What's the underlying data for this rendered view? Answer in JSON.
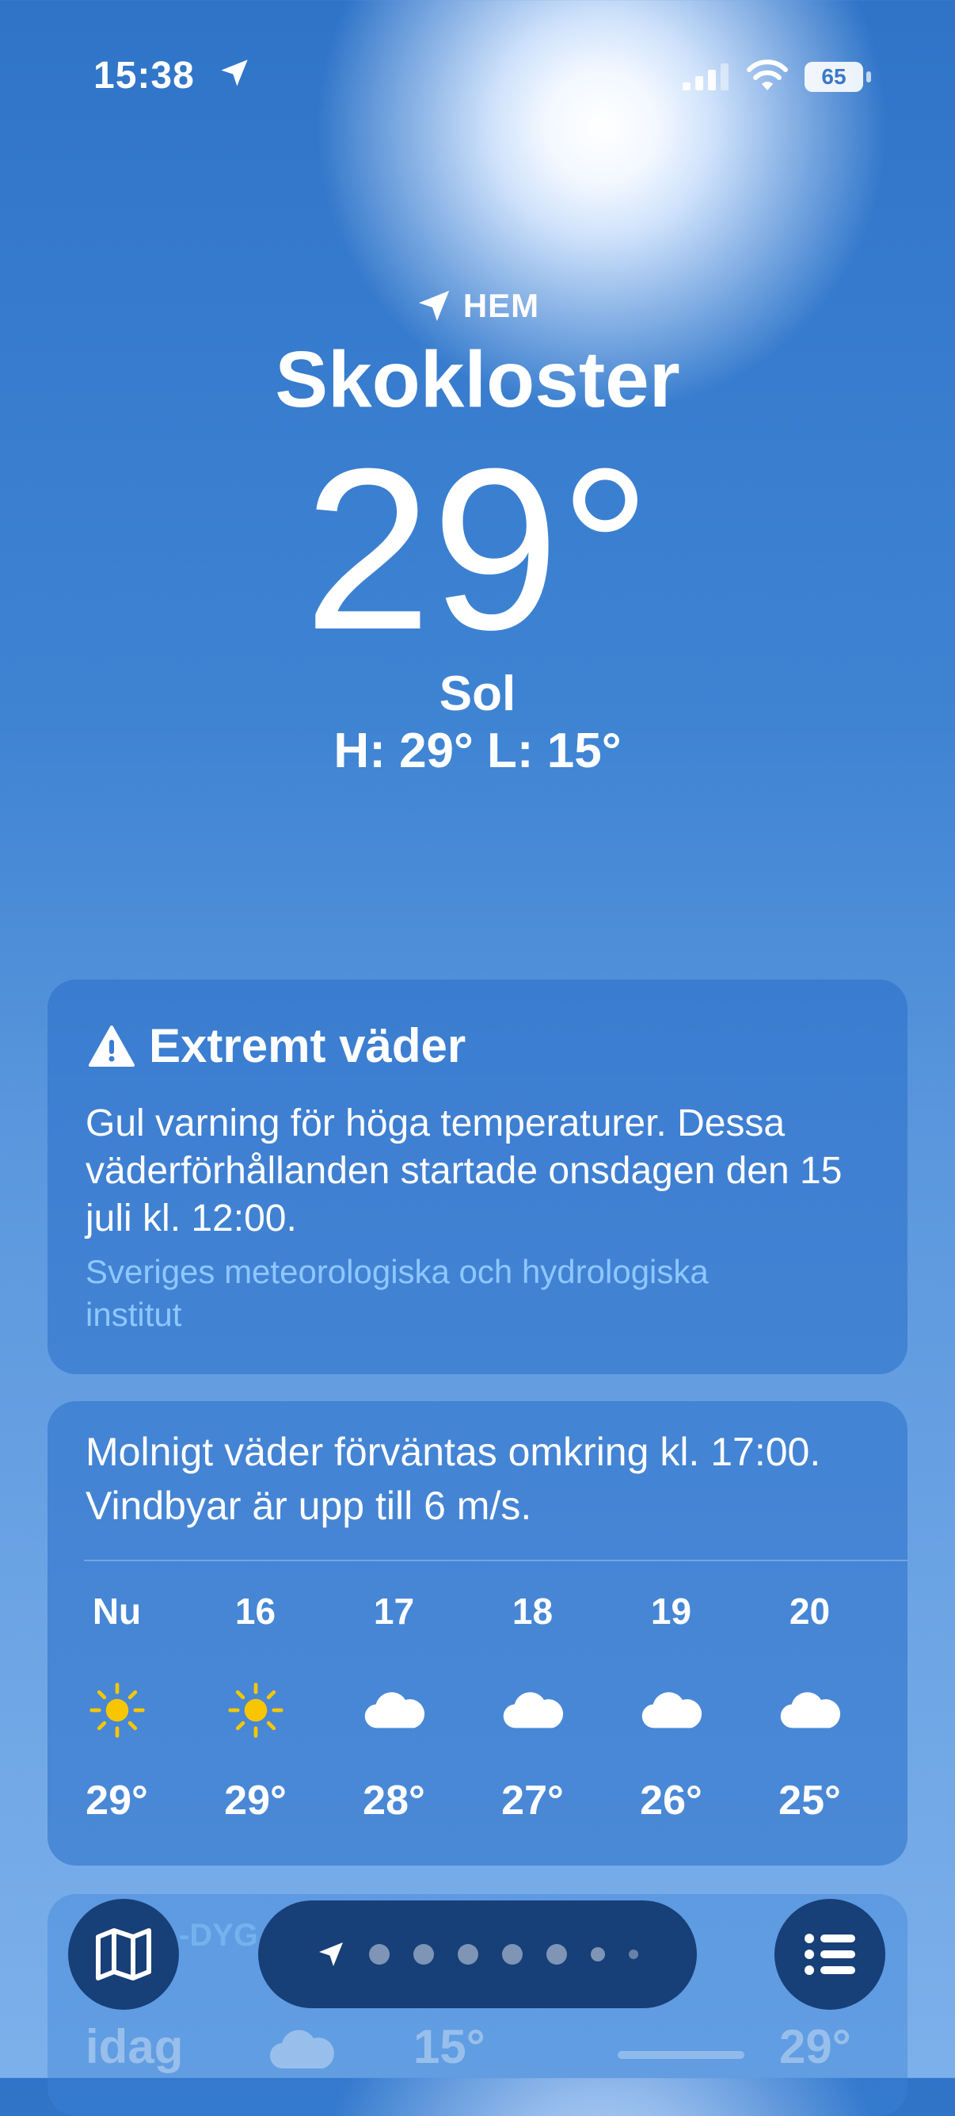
{
  "status_bar": {
    "time": "15:38",
    "battery": "65"
  },
  "header": {
    "location_tag": "HEM",
    "city": "Skokloster",
    "temperature": "29°",
    "condition": "Sol",
    "high_low": "H: 29°  L: 15°"
  },
  "alert": {
    "title": "Extremt väder",
    "text": "Gul varning för höga temperaturer. Dessa väderförhållanden startade onsdagen den 15 juli kl. 12:00.",
    "source": "Sveriges meteorologiska och hydrologiska institut"
  },
  "hourly": {
    "description": "Molnigt väder förväntas omkring kl. 17:00. Vindbyar är upp till 6 m/s.",
    "items": [
      {
        "label": "Nu",
        "icon": "sun-icon",
        "temp": "29°"
      },
      {
        "label": "16",
        "icon": "sun-icon",
        "temp": "29°"
      },
      {
        "label": "17",
        "icon": "cloud-icon",
        "temp": "28°"
      },
      {
        "label": "18",
        "icon": "cloud-icon",
        "temp": "27°"
      },
      {
        "label": "19",
        "icon": "cloud-icon",
        "temp": "26°"
      },
      {
        "label": "20",
        "icon": "cloud-icon",
        "temp": "25°"
      }
    ]
  },
  "forecast": {
    "label": "-DYG",
    "day": "idag",
    "low": "15°",
    "high": "29°"
  },
  "colors": {
    "sun": "#f7c600",
    "card": "#2f6fc4",
    "control": "#173f78",
    "source_link": "#8ec7ff"
  }
}
